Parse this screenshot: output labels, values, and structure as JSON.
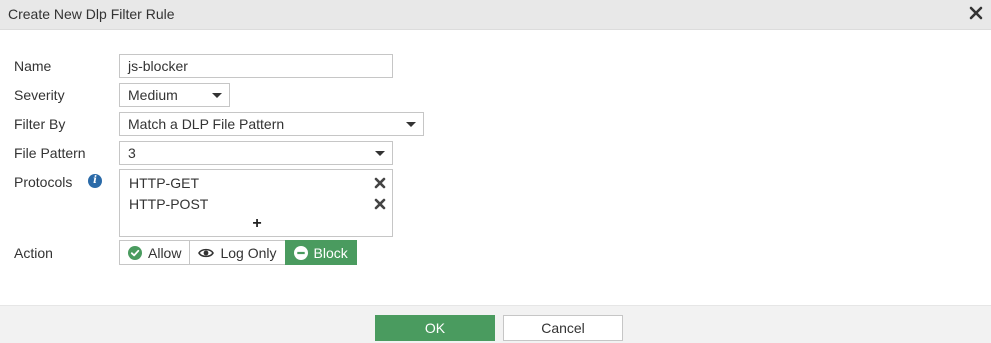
{
  "dialog": {
    "title": "Create New Dlp Filter Rule"
  },
  "form": {
    "name": {
      "label": "Name",
      "value": "js-blocker"
    },
    "severity": {
      "label": "Severity",
      "value": "Medium"
    },
    "filter_by": {
      "label": "Filter By",
      "value": "Match a DLP File Pattern"
    },
    "file_pattern": {
      "label": "File Pattern",
      "value": "3"
    },
    "protocols": {
      "label": "Protocols",
      "items": [
        "HTTP-GET",
        "HTTP-POST"
      ]
    },
    "action": {
      "label": "Action",
      "options": [
        "Allow",
        "Log Only",
        "Block"
      ],
      "selected": "Block"
    }
  },
  "footer": {
    "ok_label": "OK",
    "cancel_label": "Cancel"
  },
  "colors": {
    "accent_green": "#4a9b5f",
    "info_blue": "#2a6aa8",
    "titlebar_bg": "#e8e8e8"
  },
  "icons": {
    "close": "close-icon",
    "info": "info-icon",
    "remove": "remove-icon",
    "add": "plus-icon",
    "allow": "check-circle-icon",
    "log_only": "eye-icon",
    "block": "minus-circle-icon"
  }
}
